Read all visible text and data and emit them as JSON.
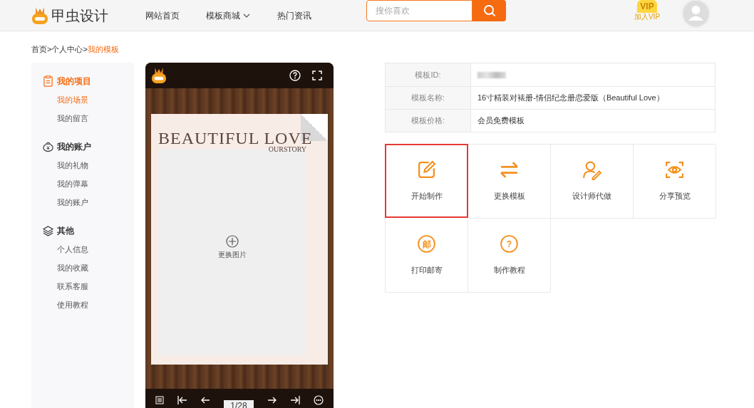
{
  "header": {
    "logo": "甲虫设计",
    "nav": [
      {
        "label": "网站首页",
        "dropdown": false
      },
      {
        "label": "模板商城",
        "dropdown": true
      },
      {
        "label": "热门资讯",
        "dropdown": false
      }
    ],
    "search": {
      "placeholder": "搜你喜欢"
    },
    "vip": {
      "badge": "VIP",
      "label": "加入VIP"
    }
  },
  "breadcrumb_separator": ">",
  "breadcrumb": [
    {
      "label": "首页",
      "current": false
    },
    {
      "label": "个人中心",
      "current": false
    },
    {
      "label": "我的模板",
      "current": true
    }
  ],
  "sidebar": {
    "groups": [
      {
        "title": "我的项目",
        "selected": true,
        "items": [
          {
            "label": "我的场景",
            "selected": true
          },
          {
            "label": "我的留言",
            "selected": false
          }
        ]
      },
      {
        "title": "我的账户",
        "selected": false,
        "items": [
          {
            "label": "我的礼物",
            "selected": false
          },
          {
            "label": "我的弹幕",
            "selected": false
          },
          {
            "label": "我的账户",
            "selected": false
          }
        ]
      },
      {
        "title": "其他",
        "selected": false,
        "items": [
          {
            "label": "个人信息",
            "selected": false
          },
          {
            "label": "我的收藏",
            "selected": false
          },
          {
            "label": "联系客服",
            "selected": false
          },
          {
            "label": "使用教程",
            "selected": false
          }
        ]
      }
    ]
  },
  "preview": {
    "title": "BEAUTIFUL LOVE",
    "subtitle": "OURSTORY",
    "placeholder": "更换图片",
    "page": "1/28"
  },
  "info": {
    "rows": [
      {
        "label": "模板ID:",
        "value": null
      },
      {
        "label": "模板名称:",
        "value": "16寸精装对裱册-情侣纪念册恋爱版（Beautiful Love）"
      },
      {
        "label": "模板价格:",
        "value": "会员免费模板"
      }
    ]
  },
  "actions": [
    {
      "label": "开始制作",
      "selected": true
    },
    {
      "label": "更换模板",
      "selected": false
    },
    {
      "label": "设计师代做",
      "selected": false
    },
    {
      "label": "分享预览",
      "selected": false
    },
    {
      "label": "打印邮寄",
      "glyph": "邮",
      "selected": false
    },
    {
      "label": "制作教程",
      "glyph": "?",
      "selected": false
    }
  ]
}
